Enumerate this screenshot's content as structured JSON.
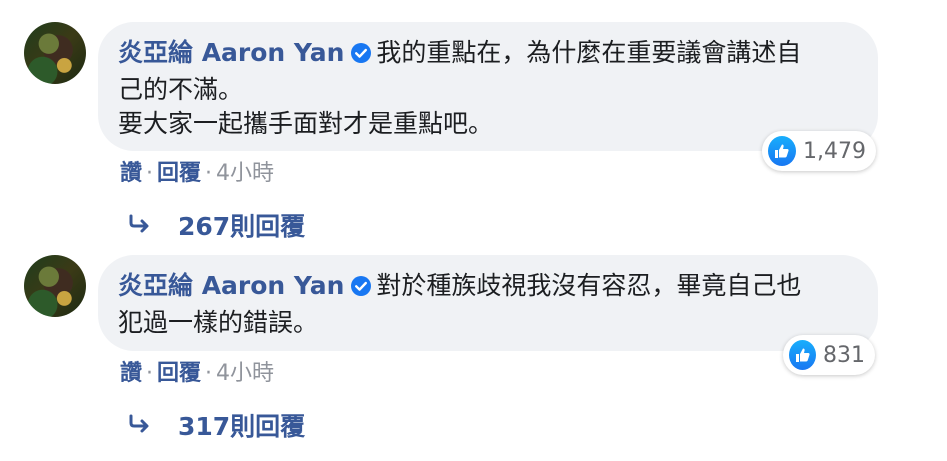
{
  "comments": [
    {
      "author": "炎亞綸 Aaron Yan",
      "text_line1": "我的重點在，為什麼在重要議會講述自",
      "text_line2": "己的不滿。",
      "text_line3": "要大家一起攜手面對才是重點吧。",
      "likes": "1,479",
      "like_label": "讚",
      "reply_label": "回覆",
      "time": "4小時",
      "replies": "267則回覆"
    },
    {
      "author": "炎亞綸 Aaron Yan",
      "text_line1": "對於種族歧視我沒有容忍，畢竟自己也",
      "text_line2": "犯過一樣的錯誤。",
      "likes": "831",
      "like_label": "讚",
      "reply_label": "回覆",
      "time": "4小時",
      "replies": "317則回覆"
    }
  ],
  "colors": {
    "link": "#385898",
    "bubble": "#f0f2f5",
    "like": "#1877f2",
    "meta": "#90949c"
  },
  "icons": {
    "verified": "verified-check-icon",
    "like": "thumbs-up-icon",
    "reply": "reply-arrow-icon"
  }
}
